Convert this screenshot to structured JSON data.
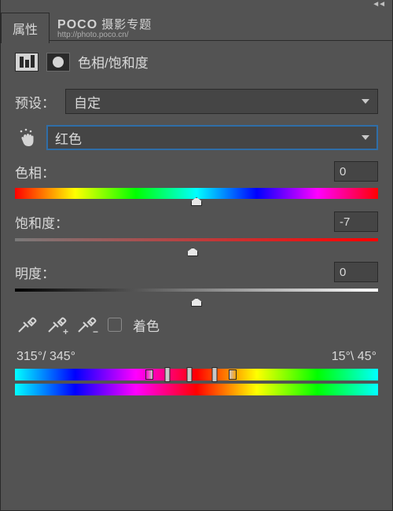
{
  "collapse_glyph": "◄◄",
  "tab_title": "属性",
  "watermark": {
    "title_bold": "POCO",
    "title_rest": " 摄影专题",
    "sub": "http://photo.poco.cn/"
  },
  "header": {
    "title": "色相/饱和度"
  },
  "preset": {
    "label": "预设：",
    "value": "自定"
  },
  "channel": {
    "value": "红色"
  },
  "hue": {
    "label": "色相：",
    "value": "0",
    "thumb_pct": 50
  },
  "saturation": {
    "label": "饱和度：",
    "value": "-7",
    "thumb_pct": 49
  },
  "lightness": {
    "label": "明度：",
    "value": "0",
    "thumb_pct": 50
  },
  "colorize": {
    "label": "着色"
  },
  "range": {
    "left": "315°/ 345°",
    "right": "15°\\ 45°",
    "markers": {
      "fade_l": 37,
      "m1": 42,
      "m2": 48,
      "m3": 55,
      "fade_r": 60
    }
  }
}
